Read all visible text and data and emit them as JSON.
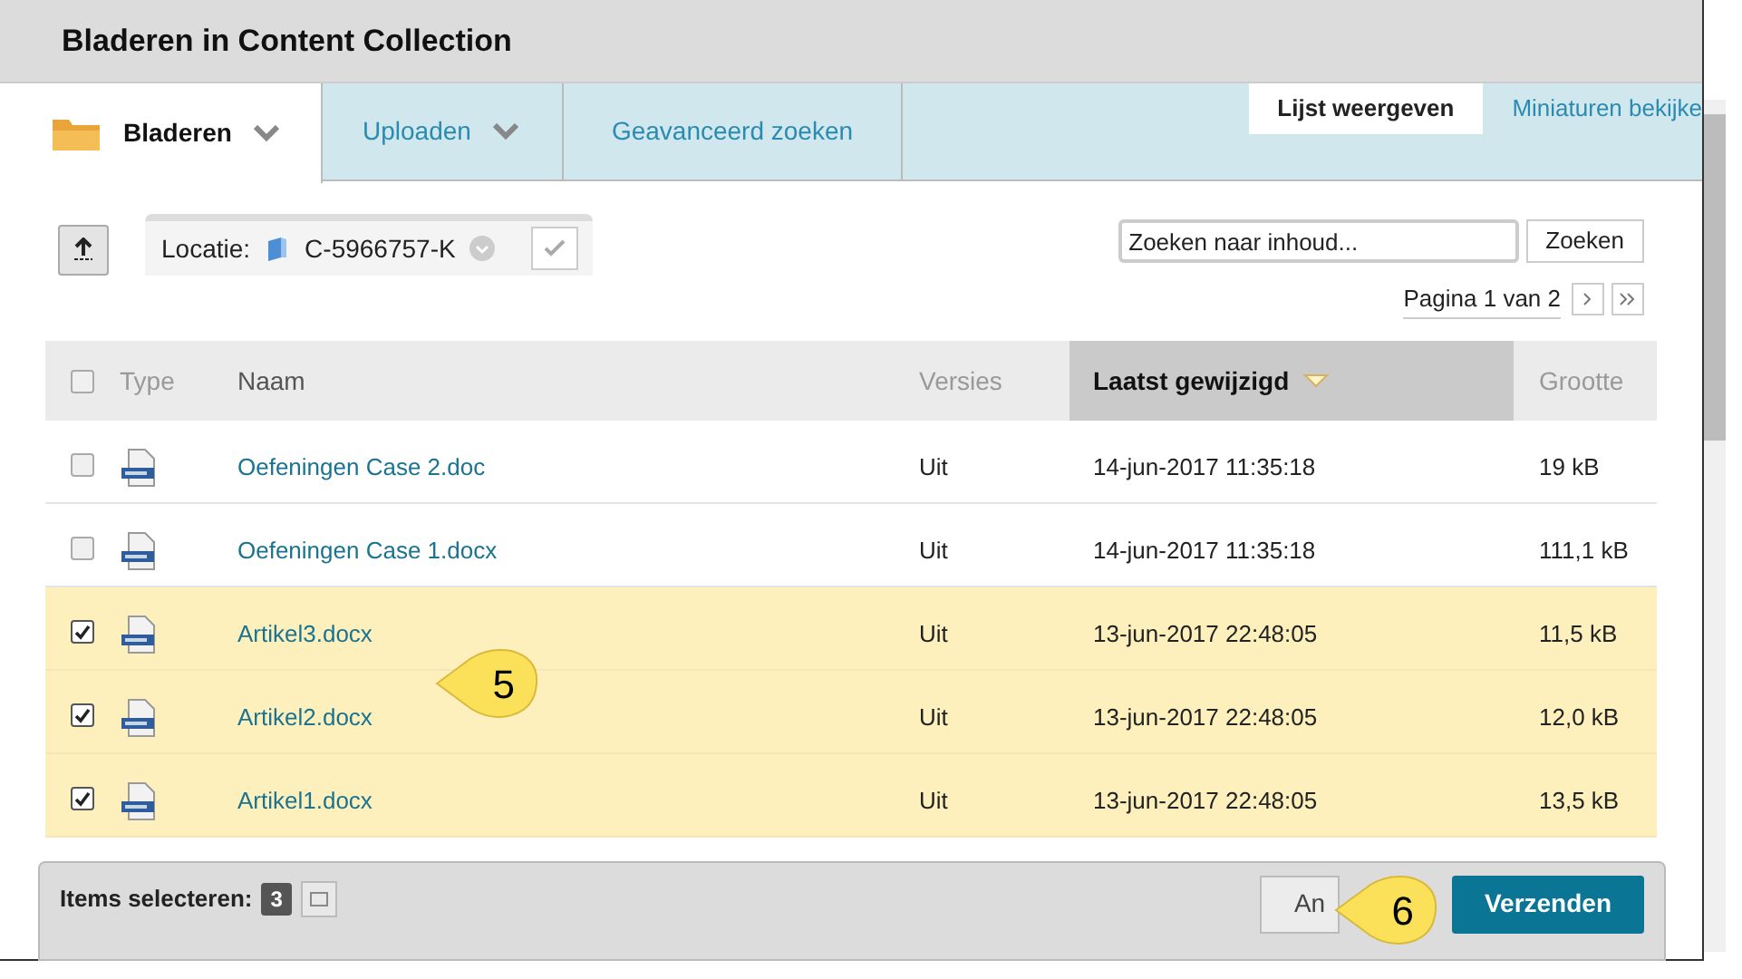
{
  "window": {
    "title": "Bladeren in Content Collection"
  },
  "tabs": [
    {
      "label": "Bladeren",
      "selected": true,
      "dropdown": true
    },
    {
      "label": "Uploaden",
      "selected": false,
      "dropdown": true
    },
    {
      "label": "Geavanceerd zoeken",
      "selected": false,
      "dropdown": false
    }
  ],
  "view_tabs": [
    {
      "label": "Lijst weergeven",
      "selected": true
    },
    {
      "label": "Miniaturen bekijke",
      "selected": false
    }
  ],
  "location": {
    "label": "Locatie:",
    "value": "C-5966757-K"
  },
  "search": {
    "placeholder": "Zoeken naar inhoud...",
    "button": "Zoeken"
  },
  "pagination": "Pagina 1 van 2",
  "table": {
    "select_all_checked": false,
    "columns": [
      {
        "label": "Type",
        "sorted": false
      },
      {
        "label": "Naam",
        "sorted": false
      },
      {
        "label": "Versies",
        "sorted": false
      },
      {
        "label": "Laatst gewijzigd",
        "sorted": true
      },
      {
        "label": "Grootte",
        "sorted": false
      }
    ],
    "rows": [
      {
        "checked": false,
        "name": "Oefeningen Case 2.doc",
        "versions": "Uit",
        "modified": "14-jun-2017 11:35:18",
        "size": "19 kB"
      },
      {
        "checked": false,
        "name": "Oefeningen Case 1.docx",
        "versions": "Uit",
        "modified": "14-jun-2017 11:35:18",
        "size": "111,1 kB"
      },
      {
        "checked": true,
        "name": "Artikel3.docx",
        "versions": "Uit",
        "modified": "13-jun-2017 22:48:05",
        "size": "11,5 kB"
      },
      {
        "checked": true,
        "name": "Artikel2.docx",
        "versions": "Uit",
        "modified": "13-jun-2017 22:48:05",
        "size": "12,0 kB"
      },
      {
        "checked": true,
        "name": "Artikel1.docx",
        "versions": "Uit",
        "modified": "13-jun-2017 22:48:05",
        "size": "13,5 kB"
      }
    ]
  },
  "footer": {
    "label": "Items selecteren:",
    "count": "3",
    "cancel": "An",
    "submit": "Verzenden"
  },
  "callouts": [
    "5",
    "6"
  ]
}
